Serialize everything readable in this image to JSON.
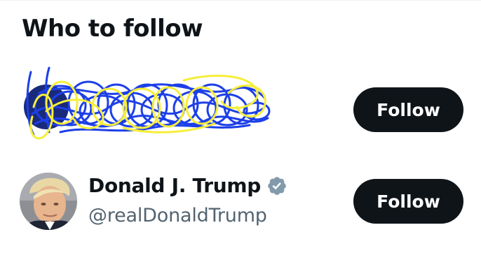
{
  "widget": {
    "title": "Who to follow"
  },
  "suggestions": [
    {
      "redacted": true,
      "follow_label": "Follow"
    },
    {
      "display_name": "Donald J. Trump",
      "verified": true,
      "handle": "@realDonaldTrump",
      "follow_label": "Follow"
    }
  ],
  "colors": {
    "button_bg": "#0f1419",
    "button_text": "#ffffff",
    "handle_text": "#536471",
    "verified_badge": "#829aab",
    "scribble_blue": "#1d3fe8",
    "scribble_yellow": "#f5ee3a"
  },
  "icons": {
    "verified": "verified-badge-icon",
    "avatar": "profile-photo"
  }
}
